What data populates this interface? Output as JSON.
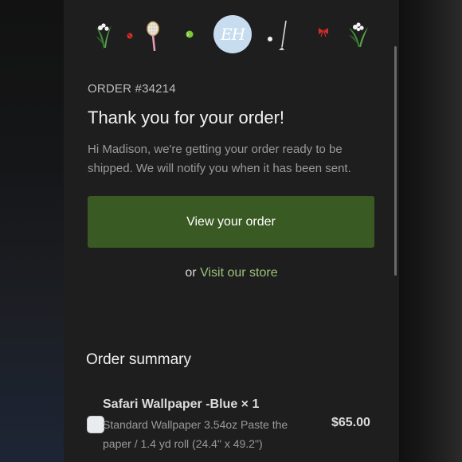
{
  "header": {
    "logo_text": "EH",
    "icons": [
      "lily-of-the-valley-icon",
      "ladybug-icon",
      "tennis-racket-icon",
      "tennis-ball-icon",
      "golf-club-icon",
      "red-bow-icon",
      "lily-of-the-valley-icon"
    ]
  },
  "order": {
    "number_label": "ORDER #34214",
    "heading": "Thank you for your order!",
    "message": "Hi Madison, we're getting your order ready to be shipped. We will notify you when it has been sent.",
    "view_button_label": "View your order",
    "or_text": "or",
    "store_link_label": "Visit our store"
  },
  "summary": {
    "title": "Order summary",
    "items": [
      {
        "title": "Safari Wallpaper -Blue × 1",
        "description": "Standard Wallpaper 3.54oz Paste the paper / 1.4 yd roll (24.4\" x 49.2\")",
        "price": "$65.00"
      }
    ]
  },
  "colors": {
    "button": "#3a5a23",
    "link": "#9cc27a",
    "background": "#1e1e1e",
    "logo": "#c7dcef"
  }
}
